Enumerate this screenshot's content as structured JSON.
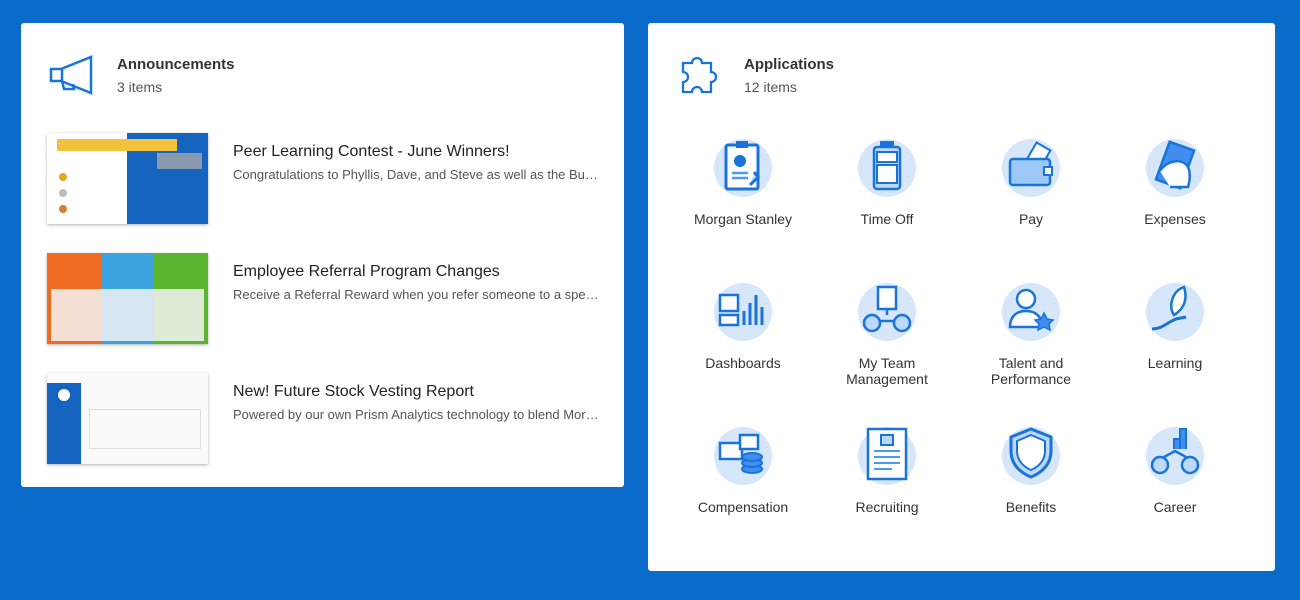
{
  "colors": {
    "background": "#0b6bcb",
    "accent": "#1a73d9",
    "icon_bg": "#d6e7fb"
  },
  "announcements": {
    "title": "Announcements",
    "count": "3 items",
    "icon": "megaphone-icon",
    "items": [
      {
        "title": "Peer Learning Contest - June Winners!",
        "description": "Congratulations to Phyllis, Dave, and Steve as well as the Budgets Development team for winning the June Peer Learning Contest",
        "thumbnail": "congratulations-banner-image"
      },
      {
        "title": "Employee Referral Program Changes",
        "description": "Receive a Referral Reward when you refer someone to a specific job",
        "thumbnail": "referral-illustration-image"
      },
      {
        "title": "New! Future Stock Vesting Report",
        "description": "Powered by our own Prism Analytics technology to blend More data",
        "thumbnail": "report-screenshot-image"
      }
    ]
  },
  "applications": {
    "title": "Applications",
    "count": "12 items",
    "icon": "puzzle-icon",
    "items": [
      {
        "label": "Morgan Stanley",
        "icon": "clipboard-chart-icon"
      },
      {
        "label": "Time Off",
        "icon": "suitcase-icon"
      },
      {
        "label": "Pay",
        "icon": "wallet-icon"
      },
      {
        "label": "Expenses",
        "icon": "hand-cash-icon"
      },
      {
        "label": "Dashboards",
        "icon": "dashboard-icon"
      },
      {
        "label": "My Team Management",
        "icon": "team-icon"
      },
      {
        "label": "Talent and Performance",
        "icon": "person-star-icon"
      },
      {
        "label": "Learning",
        "icon": "hand-leaf-icon"
      },
      {
        "label": "Compensation",
        "icon": "coins-icon"
      },
      {
        "label": "Recruiting",
        "icon": "resume-icon"
      },
      {
        "label": "Benefits",
        "icon": "shield-icon"
      },
      {
        "label": "Career",
        "icon": "career-icon"
      }
    ]
  }
}
